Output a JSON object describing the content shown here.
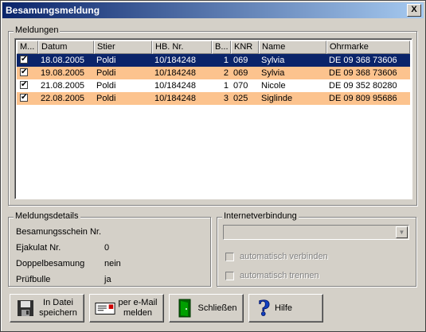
{
  "window": {
    "title": "Besamungsmeldung",
    "close_label": "X"
  },
  "meldungen": {
    "group_label": "Meldungen",
    "columns": [
      "M...",
      "Datum",
      "Stier",
      "HB. Nr.",
      "B...",
      "KNR",
      "Name",
      "Ohrmarke"
    ],
    "rows": [
      {
        "checked": true,
        "datum": "18.08.2005",
        "stier": "Poldi",
        "hb": "10/184248",
        "b": "1",
        "knr": "069",
        "name": "Sylvia",
        "ohrmarke": "DE 09 368 73606"
      },
      {
        "checked": true,
        "datum": "19.08.2005",
        "stier": "Poldi",
        "hb": "10/184248",
        "b": "2",
        "knr": "069",
        "name": "Sylvia",
        "ohrmarke": "DE 09 368 73606"
      },
      {
        "checked": true,
        "datum": "21.08.2005",
        "stier": "Poldi",
        "hb": "10/184248",
        "b": "1",
        "knr": "070",
        "name": "Nicole",
        "ohrmarke": "DE 09 352 80280"
      },
      {
        "checked": true,
        "datum": "22.08.2005",
        "stier": "Poldi",
        "hb": "10/184248",
        "b": "3",
        "knr": "025",
        "name": "Siglinde",
        "ohrmarke": "DE 09 809 95686"
      }
    ]
  },
  "details": {
    "group_label": "Meldungsdetails",
    "besamungsschein_label": "Besamungsschein Nr.",
    "ejakulat_label": "Ejakulat Nr.",
    "ejakulat_value": "0",
    "doppel_label": "Doppelbesamung",
    "doppel_value": "nein",
    "pruef_label": "Prüfbulle",
    "pruef_value": "ja"
  },
  "internet": {
    "group_label": "Internetverbindung",
    "combo_value": "",
    "auto_connect_label": "automatisch verbinden",
    "auto_disconnect_label": "automatisch trennen"
  },
  "buttons": {
    "save_file": "In Datei\nspeichern",
    "email": "per e-Mail\nmelden",
    "close": "Schließen",
    "help": "Hilfe"
  },
  "colors": {
    "selected_row": "#0a246a",
    "alt_row": "#fcc38e",
    "title_start": "#0a246a",
    "title_end": "#a6caf0"
  },
  "icons": [
    "floppy-disk-icon",
    "email-form-icon",
    "exit-door-icon",
    "help-question-icon"
  ]
}
